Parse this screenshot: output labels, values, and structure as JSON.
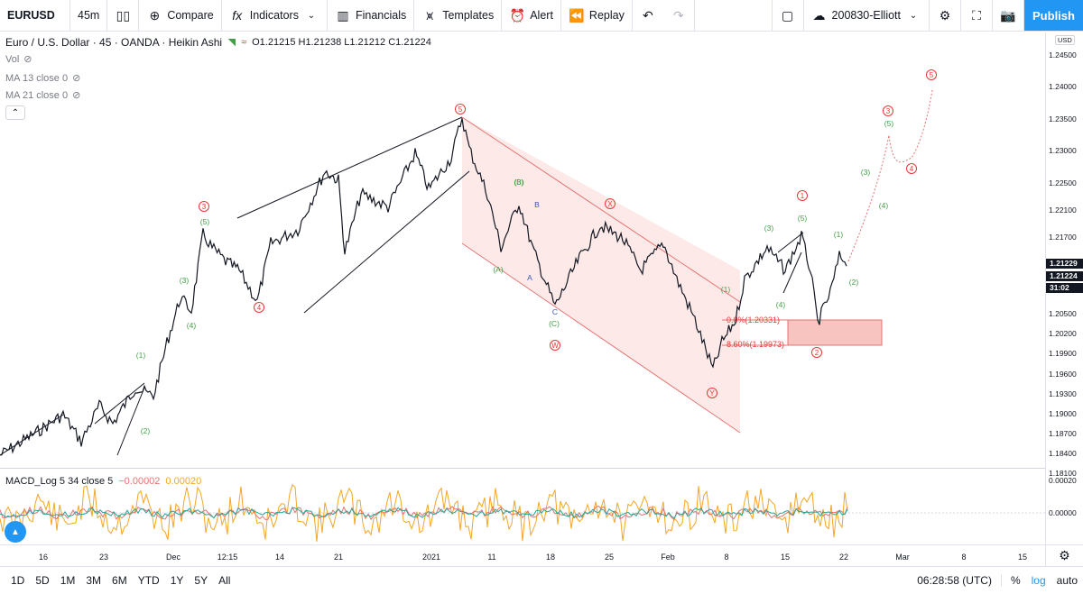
{
  "toolbar": {
    "symbol": "EURUSD",
    "interval": "45m",
    "compare_label": "Compare",
    "indicators_label": "Indicators",
    "financials_label": "Financials",
    "templates_label": "Templates",
    "alert_label": "Alert",
    "replay_label": "Replay",
    "layout_name": "200830-Elliott",
    "publish_label": "Publish"
  },
  "legend": {
    "title": "Euro / U.S. Dollar · 45 · OANDA · Heikin Ashi",
    "ohlc": "O1.21215 H1.21238 L1.21212 C1.21224",
    "vol": "Vol",
    "ma13": "MA 13 close 0",
    "ma21": "MA 21 close 0"
  },
  "price_axis": {
    "currency": "USD",
    "labels": [
      "1.24500",
      "1.24000",
      "1.23500",
      "1.23000",
      "1.22500",
      "1.22100",
      "1.21700",
      "1.21229",
      "1.21224",
      "31:02",
      "1.20500",
      "1.20200",
      "1.19900",
      "1.19600",
      "1.19300",
      "1.19000",
      "1.18700",
      "1.18400",
      "1.18100"
    ],
    "last_price": "1.21229",
    "close_price": "1.21224",
    "countdown": "31:02"
  },
  "macd": {
    "title": "MACD_Log 5 34 close 5",
    "value1": "−0.00002",
    "value2": "0.00020",
    "axis": [
      "0.00020",
      "0.00000"
    ]
  },
  "time_axis": [
    "16",
    "23",
    "Dec",
    "12:15",
    "14",
    "21",
    "2021",
    "11",
    "18",
    "25",
    "Feb",
    "8",
    "15",
    "22",
    "Mar",
    "8",
    "15"
  ],
  "bottom": {
    "ranges": [
      "1D",
      "5D",
      "1M",
      "3M",
      "6M",
      "YTD",
      "1Y",
      "5Y",
      "All"
    ],
    "clock": "06:28:58 (UTC)",
    "percent": "%",
    "log": "log",
    "auto": "auto"
  },
  "annotations": {
    "fib1": "0.0%(1.20331)",
    "fib2": "8.60%(1.19973)",
    "wave_labels": [
      "5",
      "3",
      "4",
      "W",
      "X",
      "Y",
      "1",
      "2",
      "3",
      "4",
      "5",
      "(5)",
      "(3)",
      "(4)",
      "(1)",
      "(2)",
      "(A)",
      "(B)",
      "(C)",
      "A",
      "B",
      "C"
    ]
  },
  "colors": {
    "accent": "#2196f3",
    "red": "#e53935",
    "green": "#43a047",
    "candle": "#131722",
    "macd_orange": "#f5a623"
  }
}
